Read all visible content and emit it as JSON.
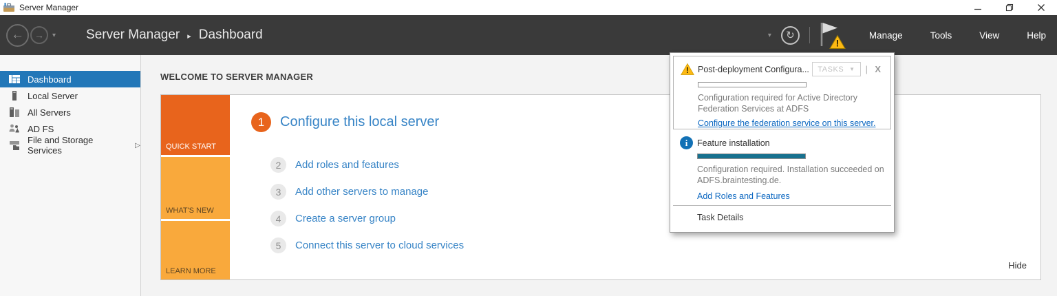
{
  "colors": {
    "navbar_bg": "#3a3a3a",
    "titlebar_bg": "#ffffff",
    "sidebar_selected_bg": "#2277b8",
    "link_blue": "#3784c6",
    "hyperlink_blue": "#0d68c1",
    "quick_start_orange": "#e8641c",
    "amber": "#f9a93c",
    "warning_yellow": "#fdb913",
    "info_blue": "#1271b5",
    "progress_teal": "#17718f",
    "content_bg": "#f3f3f3",
    "tile_border": "#c5c5c5"
  },
  "icons": {
    "back_arrow": "←",
    "forward_arrow": "→",
    "dropdown_caret": "▾",
    "refresh": "↻",
    "breadcrumb_separator": "▸",
    "sidebar_chevron": "▷",
    "tasks_caret": "▼",
    "popup_close": "X",
    "warning_mark": "!",
    "info_i": "i"
  },
  "titlebar": {
    "title": "Server Manager"
  },
  "navbar": {
    "breadcrumb_root": "Server Manager",
    "breadcrumb_current": "Dashboard",
    "menus": [
      {
        "label": "Manage"
      },
      {
        "label": "Tools"
      },
      {
        "label": "View"
      },
      {
        "label": "Help"
      }
    ]
  },
  "sidebar": {
    "items": [
      {
        "label": "Dashboard"
      },
      {
        "label": "Local Server"
      },
      {
        "label": "All Servers"
      },
      {
        "label": "AD FS"
      },
      {
        "label": "File and Storage Services"
      }
    ]
  },
  "main": {
    "heading": "WELCOME TO SERVER MANAGER",
    "tabs": [
      {
        "label": "QUICK START"
      },
      {
        "label": "WHAT'S NEW"
      },
      {
        "label": "LEARN MORE"
      }
    ],
    "steps": [
      {
        "num": "1",
        "label": "Configure this local server"
      },
      {
        "num": "2",
        "label": "Add roles and features"
      },
      {
        "num": "3",
        "label": "Add other servers to manage"
      },
      {
        "num": "4",
        "label": "Create a server group"
      },
      {
        "num": "5",
        "label": "Connect this server to cloud services"
      }
    ],
    "hide_label": "Hide"
  },
  "popup": {
    "warning": {
      "title": "Post-deployment Configura...",
      "tasks_label": "TASKS",
      "progress_percent": 0,
      "description": "Configuration required for Active Directory Federation Services at ADFS",
      "link": "Configure the federation service on this server."
    },
    "info": {
      "title": "Feature installation",
      "progress_percent": 100,
      "description": "Configuration required. Installation succeeded on ADFS.braintesting.de.",
      "link": "Add Roles and Features"
    },
    "task_details_label": "Task Details"
  }
}
